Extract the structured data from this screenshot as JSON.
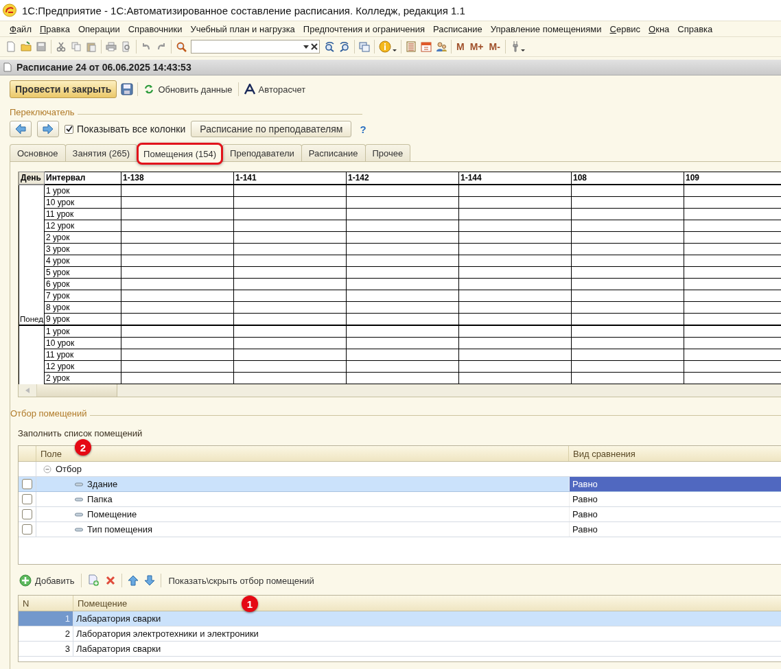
{
  "window": {
    "title": "1С:Предприятие - 1С:Автоматизированное составление расписания. Колледж, редакция 1.1"
  },
  "menu": [
    {
      "label": "Файл",
      "mnemonic": true
    },
    {
      "label": "Правка",
      "mnemonic": true
    },
    {
      "label": "Операции",
      "mnemonic": false
    },
    {
      "label": "Справочники",
      "mnemonic": false
    },
    {
      "label": "Учебный план и нагрузка",
      "mnemonic": false
    },
    {
      "label": "Предпочтения и ограничения",
      "mnemonic": false
    },
    {
      "label": "Расписание",
      "mnemonic": false
    },
    {
      "label": "Управление помещениями",
      "mnemonic": false
    },
    {
      "label": "Сервис",
      "mnemonic": true
    },
    {
      "label": "Окна",
      "mnemonic": true
    },
    {
      "label": "Справка",
      "mnemonic": false
    }
  ],
  "toolbar": {
    "memory_buttons": [
      "M",
      "M+",
      "M-"
    ]
  },
  "document": {
    "title": "Расписание 24 от 06.06.2025 14:43:53"
  },
  "commands": {
    "primary": "Провести и закрыть",
    "refresh": "Обновить данные",
    "autocalc": "Авторасчет"
  },
  "switcher": {
    "title": "Переключатель",
    "show_all_columns": {
      "label": "Показывать все колонки",
      "checked": true
    },
    "button": "Расписание по преподавателям",
    "help": "?"
  },
  "tabs": [
    {
      "label": "Основное",
      "selected": false,
      "circled": false
    },
    {
      "label": "Занятия (265)",
      "selected": false,
      "circled": false
    },
    {
      "label": "Помещения (154)",
      "selected": true,
      "circled": true
    },
    {
      "label": "Преподаватели",
      "selected": false,
      "circled": false
    },
    {
      "label": "Расписание",
      "selected": false,
      "circled": false
    },
    {
      "label": "Прочее",
      "selected": false,
      "circled": false
    }
  ],
  "grid": {
    "columns": [
      "День",
      "Интервал",
      "1-138",
      "1-141",
      "1-142",
      "1-144",
      "108",
      "109"
    ],
    "days": [
      {
        "day": "Понед",
        "intervals": [
          "1 урок",
          "10 урок",
          "11 урок",
          "12 урок",
          "2 урок",
          "3 урок",
          "4 урок",
          "5 урок",
          "6 урок",
          "7 урок",
          "8 урок",
          "9 урок"
        ]
      },
      {
        "intervals": [
          "1 урок",
          "10 урок",
          "11 урок",
          "12 урок",
          "2 урок"
        ]
      }
    ]
  },
  "filter": {
    "title": "Отбор помещений",
    "fill_link": "Заполнить список помещений",
    "badge": "2",
    "columns": [
      "Поле",
      "Вид сравнения"
    ],
    "group": {
      "label": "Отбор",
      "expanded": true,
      "children": [
        {
          "field": "Здание",
          "comparison": "Равно",
          "checked": false,
          "selected": true
        },
        {
          "field": "Папка",
          "comparison": "Равно",
          "checked": false,
          "selected": false
        },
        {
          "field": "Помещение",
          "comparison": "Равно",
          "checked": false,
          "selected": false
        },
        {
          "field": "Тип помещения",
          "comparison": "Равно",
          "checked": false,
          "selected": false
        }
      ]
    }
  },
  "list_toolbar": {
    "add": "Добавить",
    "toggle": "Показать\\скрыть отбор помещений"
  },
  "rooms": {
    "badge": "1",
    "columns": [
      "N",
      "Помещение"
    ],
    "rows": [
      {
        "n": "1",
        "name": "Лабаратория сварки",
        "selected": true
      },
      {
        "n": "2",
        "name": "Лаборатория электротехники и электроники",
        "selected": false
      },
      {
        "n": "3",
        "name": "Лабаратория сварки",
        "selected": false
      }
    ]
  }
}
